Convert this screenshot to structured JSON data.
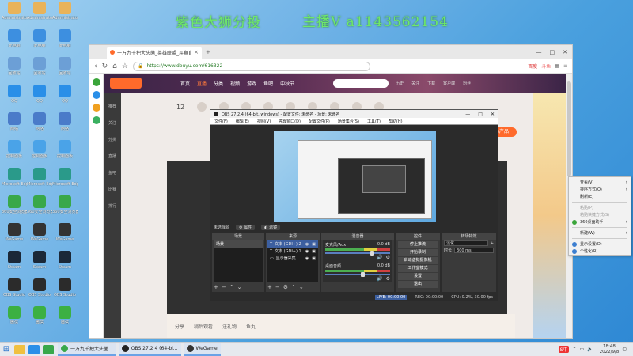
{
  "overlay": {
    "left_text": "紫色大狮分投",
    "right_text": "主播V a1143562154"
  },
  "desktop_icons": [
    {
      "label": "Administrator",
      "color": "#e9b35a"
    },
    {
      "label": "此电脑",
      "color": "#3d8fe0"
    },
    {
      "label": "回收站",
      "color": "#6c9fd6"
    },
    {
      "label": "QQ",
      "color": "#2a8fe8"
    },
    {
      "label": "网络",
      "color": "#4a7bc9"
    },
    {
      "label": "控制面板",
      "color": "#4aa3e8"
    },
    {
      "label": "Microsoft Edge",
      "color": "#2a9a8a"
    },
    {
      "label": "360安全浏览器",
      "color": "#39a84a"
    },
    {
      "label": "WeGame",
      "color": "#333333"
    },
    {
      "label": "Steam",
      "color": "#1b2838"
    },
    {
      "label": "OBS Studio",
      "color": "#2b2b2b"
    },
    {
      "label": "微信",
      "color": "#3cb043"
    }
  ],
  "browser": {
    "tab_title": "一万九千把大头菌_英雄联盟_斗鱼直播",
    "url": "https://www.douyu.com/616322",
    "extension_labels": [
      "百度",
      "斗鱼"
    ]
  },
  "douyu": {
    "nav_items": [
      "首页",
      "直播",
      "分类",
      "视频",
      "游戏",
      "鱼吧",
      "中秋节"
    ],
    "active_nav": "直播",
    "header_icons": [
      "历史",
      "关注",
      "下载",
      "客户端",
      "粉丝"
    ],
    "rail_items": [
      "推荐",
      "关注",
      "分类",
      "直播",
      "鱼吧",
      "比赛",
      "排行"
    ],
    "pcb_label": "PCB产品",
    "bottom_items": [
      "分享",
      "稍后观看",
      "送礼物",
      "鱼丸"
    ],
    "gift_count": "12"
  },
  "obs": {
    "title": "OBS 27.2.4 (64-bit, windows) - 配置文件: 未命名 - 场景: 未命名",
    "menu": [
      "文件(F)",
      "编辑(E)",
      "视图(V)",
      "停靠窗口(D)",
      "配置文件(P)",
      "场景集合(S)",
      "工具(T)",
      "帮助(H)"
    ],
    "toolbar_label": "未选择源",
    "toolbar_buttons": [
      "属性",
      "滤镜"
    ],
    "docks": {
      "scenes": {
        "title": "场景",
        "items": [
          "场景"
        ]
      },
      "sources": {
        "title": "来源",
        "items": [
          {
            "name": "文本 (GDI+) 2",
            "selected": true
          },
          {
            "name": "文本 (GDI+) 1",
            "selected": false
          },
          {
            "name": "显示器采集",
            "selected": false
          }
        ]
      },
      "mixer": {
        "title": "混音器",
        "channels": [
          {
            "name": "麦克风/Aux",
            "db": "0.0 dB",
            "level": 0.7
          },
          {
            "name": "桌面音频",
            "db": "0.0 dB",
            "level": 0.55
          }
        ]
      },
      "transitions": {
        "title": "转场特效",
        "type": "淡化",
        "duration_label": "时长",
        "duration": "300 ms"
      },
      "controls": {
        "title": "控件",
        "buttons": [
          "停止推流",
          "开始录制",
          "启动虚拟摄像机",
          "工作室模式",
          "设置",
          "退出"
        ]
      }
    },
    "status": {
      "live": "LIVE: 00:00:00",
      "rec": "REC: 00:00:00",
      "cpu": "CPU: 0.2%, 30.00 fps"
    }
  },
  "context_menu": {
    "items": [
      {
        "label": "查看(V)",
        "arrow": true,
        "disabled": false,
        "icon": null
      },
      {
        "label": "排序方式(O)",
        "arrow": true,
        "disabled": false,
        "icon": null
      },
      {
        "label": "刷新(E)",
        "arrow": false,
        "disabled": false,
        "icon": null
      },
      {
        "sep": true
      },
      {
        "label": "粘贴(P)",
        "arrow": false,
        "disabled": true,
        "icon": null
      },
      {
        "label": "粘贴快捷方式(S)",
        "arrow": false,
        "disabled": true,
        "icon": null
      },
      {
        "label": "360桌面助手",
        "arrow": true,
        "disabled": false,
        "icon": "#3aa53a"
      },
      {
        "sep": true
      },
      {
        "label": "新建(W)",
        "arrow": true,
        "disabled": false,
        "icon": null
      },
      {
        "sep": true
      },
      {
        "label": "显示设置(D)",
        "arrow": false,
        "disabled": false,
        "icon": "#3d7fd0"
      },
      {
        "label": "个性化(R)",
        "arrow": false,
        "disabled": false,
        "icon": "#3d7fd0"
      }
    ]
  },
  "taskbar": {
    "tasks": [
      {
        "label": "一万九千把大头菌...",
        "color": "#39a84a"
      },
      {
        "label": "OBS 27.2.4 (64-bi...",
        "color": "#222222"
      },
      {
        "label": "WeGame",
        "color": "#333333"
      }
    ],
    "time": "18:48",
    "date": "2022/9/8",
    "ime": "S中"
  }
}
